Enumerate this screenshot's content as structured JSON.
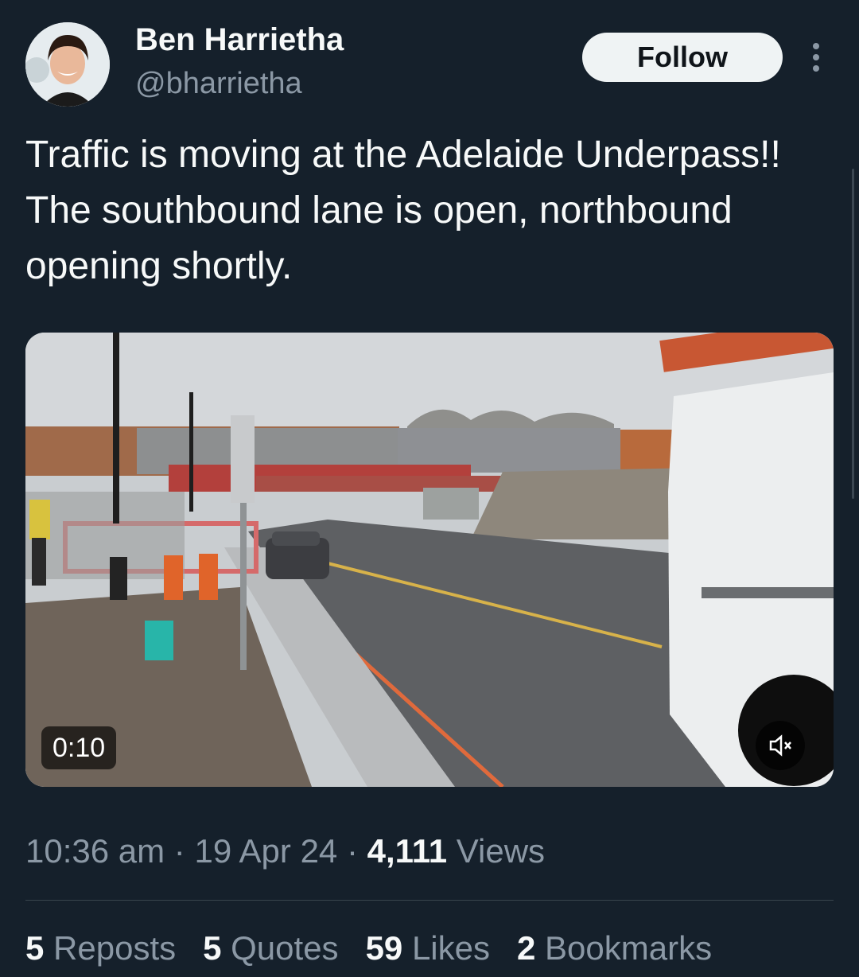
{
  "author": {
    "name": "Ben Harrietha",
    "handle": "@bharrietha",
    "follow_label": "Follow"
  },
  "tweet": {
    "text": "Traffic is moving at the Adelaide Underpass!! The southbound lane is open, northbound opening shortly."
  },
  "media": {
    "duration": "0:10",
    "mute_icon": "volume-muted-icon"
  },
  "meta": {
    "time": "10:36 am",
    "separator": "·",
    "date": "19 Apr 24",
    "views_count": "4,111",
    "views_label": "Views"
  },
  "stats": [
    {
      "count": "5",
      "label": "Reposts"
    },
    {
      "count": "5",
      "label": "Quotes"
    },
    {
      "count": "59",
      "label": "Likes"
    },
    {
      "count": "2",
      "label": "Bookmarks"
    }
  ],
  "colors": {
    "background": "#15202b",
    "secondary_text": "#8b98a5",
    "follow_button_bg": "#eff3f4"
  }
}
